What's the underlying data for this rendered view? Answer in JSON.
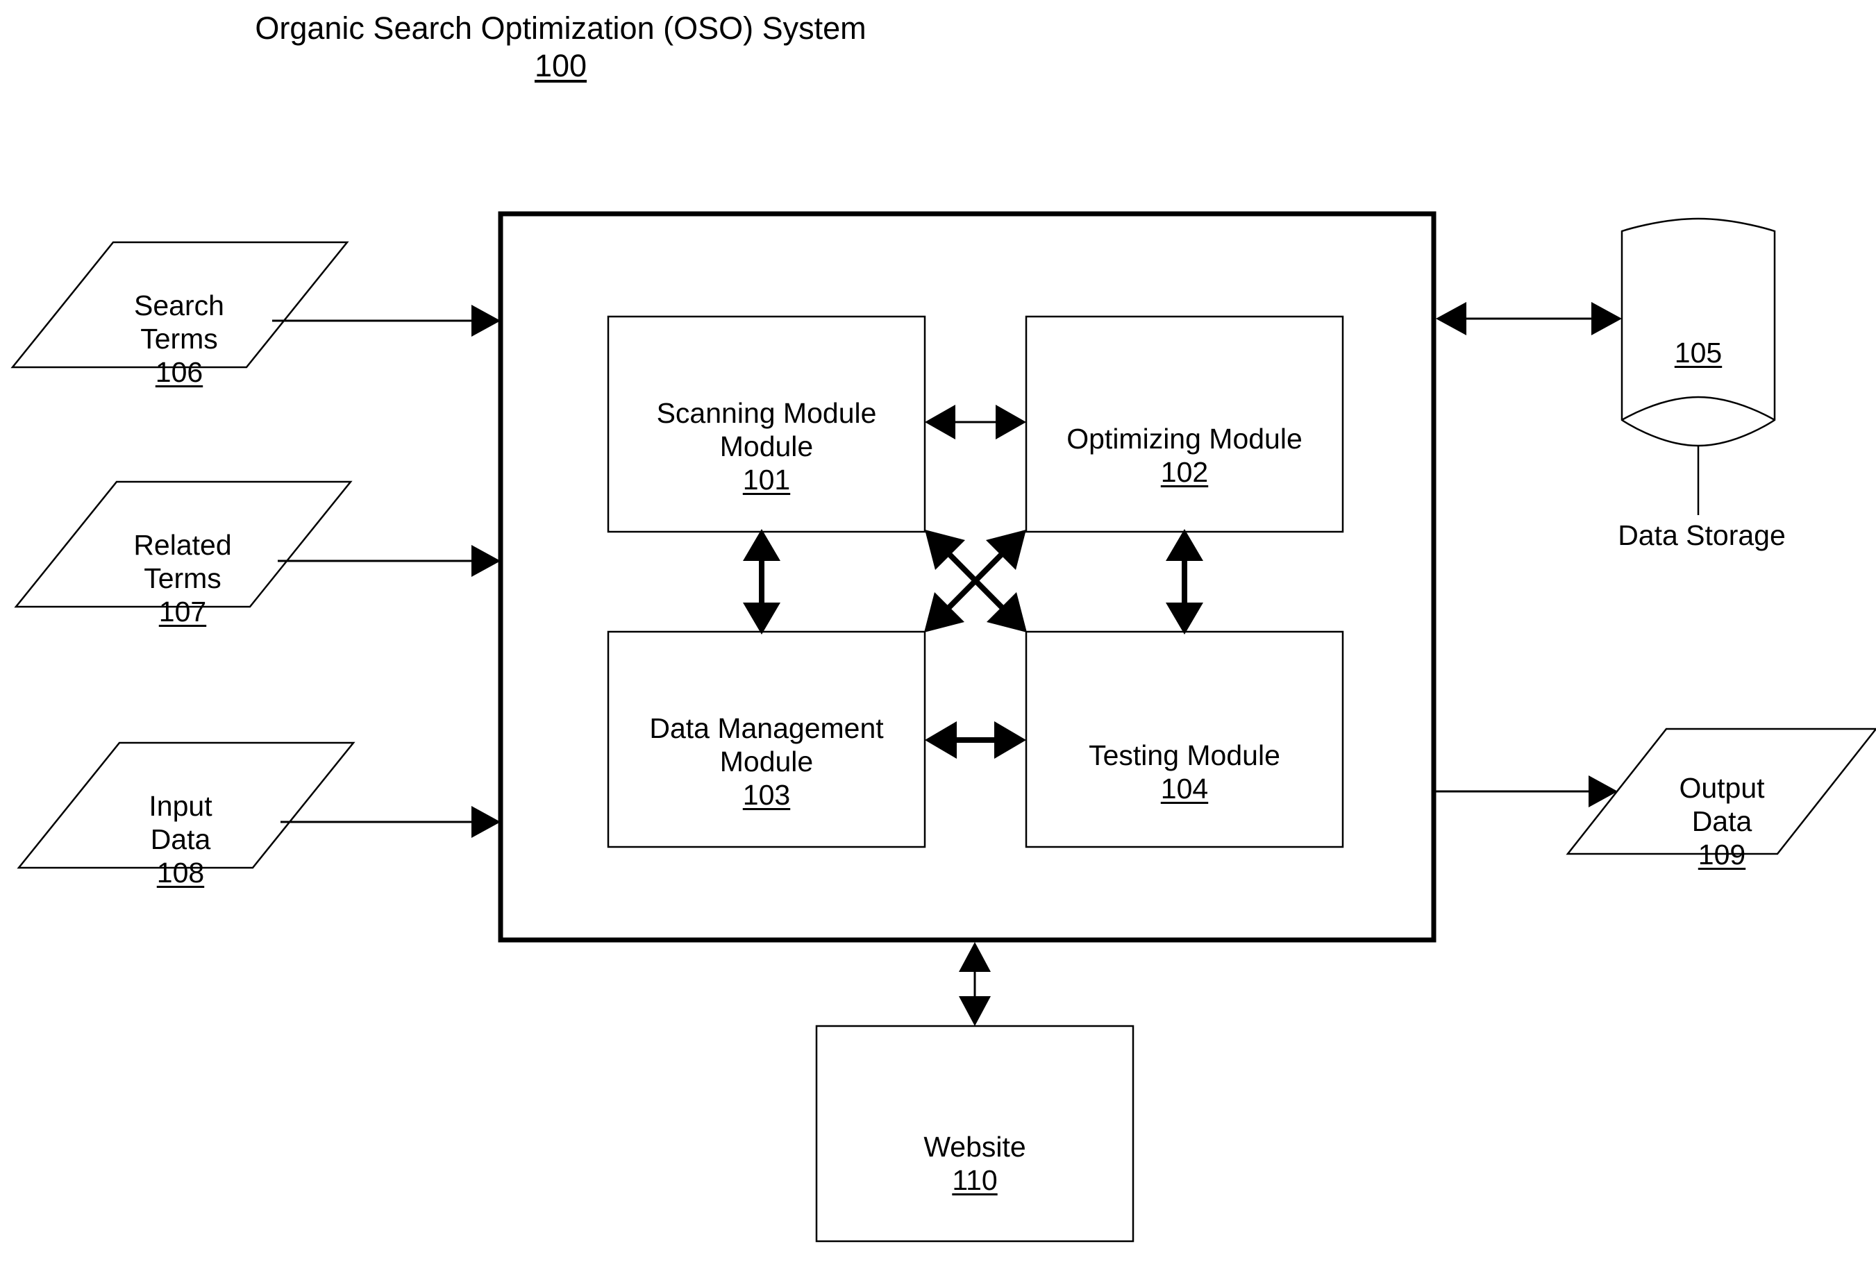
{
  "diagram": {
    "title": "Organic Search Optimization (OSO) System",
    "title_ref": "100",
    "system_boundary": {
      "name": "OSO System boundary",
      "ref": "100"
    },
    "inputs": [
      {
        "label": "Search\nTerms",
        "ref": "106",
        "shape": "parallelogram"
      },
      {
        "label": "Related\nTerms",
        "ref": "107",
        "shape": "parallelogram"
      },
      {
        "label": "Input\nData",
        "ref": "108",
        "shape": "parallelogram"
      }
    ],
    "modules": [
      {
        "label": "Scanning Module\nModule",
        "ref": "101",
        "shape": "rectangle"
      },
      {
        "label": "Optimizing Module",
        "ref": "102",
        "shape": "rectangle"
      },
      {
        "label": "Data Management\nModule",
        "ref": "103",
        "shape": "rectangle"
      },
      {
        "label": "Testing Module",
        "ref": "104",
        "shape": "rectangle"
      }
    ],
    "storage": {
      "ref": "105",
      "caption": "Data Storage",
      "shape": "cylinder"
    },
    "outputs": [
      {
        "label": "Output\nData",
        "ref": "109",
        "shape": "parallelogram"
      }
    ],
    "external": [
      {
        "label": "Website",
        "ref": "110",
        "shape": "rectangle"
      }
    ],
    "connections": [
      {
        "from": "Search Terms 106",
        "to": "OSO System 100",
        "arrows": "single"
      },
      {
        "from": "Related Terms 107",
        "to": "OSO System 100",
        "arrows": "single"
      },
      {
        "from": "Input Data 108",
        "to": "OSO System 100",
        "arrows": "single"
      },
      {
        "from": "OSO System 100",
        "to": "Data Storage 105",
        "arrows": "double"
      },
      {
        "from": "OSO System 100",
        "to": "Output Data 109",
        "arrows": "single"
      },
      {
        "from": "OSO System 100",
        "to": "Website 110",
        "arrows": "double"
      },
      {
        "from": "Scanning Module 101",
        "to": "Optimizing Module 102",
        "arrows": "double"
      },
      {
        "from": "Scanning Module 101",
        "to": "Data Management Module 103",
        "arrows": "double"
      },
      {
        "from": "Optimizing Module 102",
        "to": "Testing Module 104",
        "arrows": "double"
      },
      {
        "from": "Data Management Module 103",
        "to": "Testing Module 104",
        "arrows": "double"
      },
      {
        "from": "Scanning Module 101",
        "to": "Testing Module 104",
        "arrows": "double"
      },
      {
        "from": "Optimizing Module 102",
        "to": "Data Management Module 103",
        "arrows": "double"
      }
    ],
    "colors": {
      "stroke": "#000000",
      "background": "#ffffff",
      "text": "#000000"
    }
  }
}
